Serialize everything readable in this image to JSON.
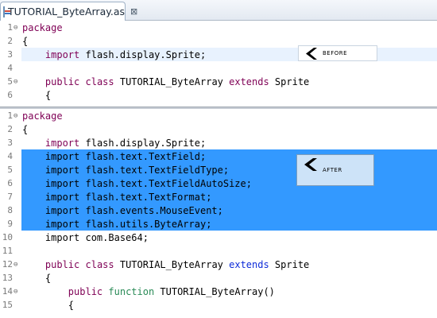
{
  "tab": {
    "filename": "TUTORIAL_ByteArray.as",
    "close_symbol": "⊠"
  },
  "before": {
    "callout_label": "BEFORE",
    "lines": [
      {
        "num": "1",
        "fold": "⊖",
        "tokens": [
          {
            "t": "package",
            "c": "kw"
          }
        ]
      },
      {
        "num": "2",
        "fold": "",
        "tokens": [
          {
            "t": "{",
            "c": ""
          }
        ]
      },
      {
        "num": "3",
        "fold": "",
        "tokens": [
          {
            "t": "    ",
            "c": ""
          },
          {
            "t": "import",
            "c": "kw"
          },
          {
            "t": " flash.display.Sprite;",
            "c": ""
          }
        ]
      },
      {
        "num": "4",
        "fold": "",
        "tokens": []
      },
      {
        "num": "5",
        "fold": "⊖",
        "tokens": [
          {
            "t": "    ",
            "c": ""
          },
          {
            "t": "public",
            "c": "kw"
          },
          {
            "t": " ",
            "c": ""
          },
          {
            "t": "class",
            "c": "kw"
          },
          {
            "t": " TUTORIAL_ByteArray ",
            "c": ""
          },
          {
            "t": "extends",
            "c": "kw"
          },
          {
            "t": " Sprite",
            "c": ""
          }
        ]
      },
      {
        "num": "6",
        "fold": "",
        "tokens": [
          {
            "t": "    {",
            "c": ""
          }
        ]
      }
    ]
  },
  "after": {
    "callout_label": "AFTER",
    "lines": [
      {
        "num": "1",
        "fold": "⊖",
        "tokens": [
          {
            "t": "package",
            "c": "kw"
          }
        ]
      },
      {
        "num": "2",
        "fold": "",
        "tokens": [
          {
            "t": "{",
            "c": ""
          }
        ]
      },
      {
        "num": "3",
        "fold": "",
        "tokens": [
          {
            "t": "    ",
            "c": ""
          },
          {
            "t": "import",
            "c": "kw"
          },
          {
            "t": " flash.display.Sprite;",
            "c": ""
          }
        ]
      },
      {
        "num": "4",
        "fold": "",
        "tokens": [
          {
            "t": "    import flash.text.TextField;",
            "c": ""
          }
        ]
      },
      {
        "num": "5",
        "fold": "",
        "tokens": [
          {
            "t": "    import flash.text.TextFieldType;",
            "c": ""
          }
        ]
      },
      {
        "num": "6",
        "fold": "",
        "tokens": [
          {
            "t": "    import flash.text.TextFieldAutoSize;",
            "c": ""
          }
        ]
      },
      {
        "num": "7",
        "fold": "",
        "tokens": [
          {
            "t": "    import flash.text.TextFormat;",
            "c": ""
          }
        ]
      },
      {
        "num": "8",
        "fold": "",
        "tokens": [
          {
            "t": "    import flash.events.MouseEvent;",
            "c": ""
          }
        ]
      },
      {
        "num": "9",
        "fold": "",
        "tokens": [
          {
            "t": "    import flash.utils.ByteArray;",
            "c": ""
          }
        ]
      },
      {
        "num": "10",
        "fold": "",
        "tokens": [
          {
            "t": "    import com.Base64;",
            "c": ""
          }
        ]
      },
      {
        "num": "11",
        "fold": "",
        "tokens": []
      },
      {
        "num": "12",
        "fold": "⊖",
        "tokens": [
          {
            "t": "    ",
            "c": ""
          },
          {
            "t": "public",
            "c": "kw"
          },
          {
            "t": " ",
            "c": ""
          },
          {
            "t": "class",
            "c": "kw"
          },
          {
            "t": " TUTORIAL_ByteArray ",
            "c": ""
          },
          {
            "t": "extends",
            "c": "kwb"
          },
          {
            "t": " Sprite",
            "c": ""
          }
        ]
      },
      {
        "num": "13",
        "fold": "",
        "tokens": [
          {
            "t": "    {",
            "c": ""
          }
        ]
      },
      {
        "num": "14",
        "fold": "⊖",
        "tokens": [
          {
            "t": "        ",
            "c": ""
          },
          {
            "t": "public",
            "c": "kw"
          },
          {
            "t": " ",
            "c": ""
          },
          {
            "t": "function",
            "c": "kwg"
          },
          {
            "t": " TUTORIAL_ByteArray()",
            "c": ""
          }
        ]
      },
      {
        "num": "15",
        "fold": "",
        "tokens": [
          {
            "t": "        {",
            "c": ""
          }
        ]
      }
    ]
  },
  "colors": {
    "selection": "#3399ff",
    "keyword": "#7f0055",
    "keyword_blue": "#0d2bd9",
    "keyword_green": "#2a8b57",
    "current_line": "#e8f2fe"
  },
  "icons": {
    "tab_file": "actionscript-file-icon",
    "callout_arrow": "chevron-left-icon"
  }
}
